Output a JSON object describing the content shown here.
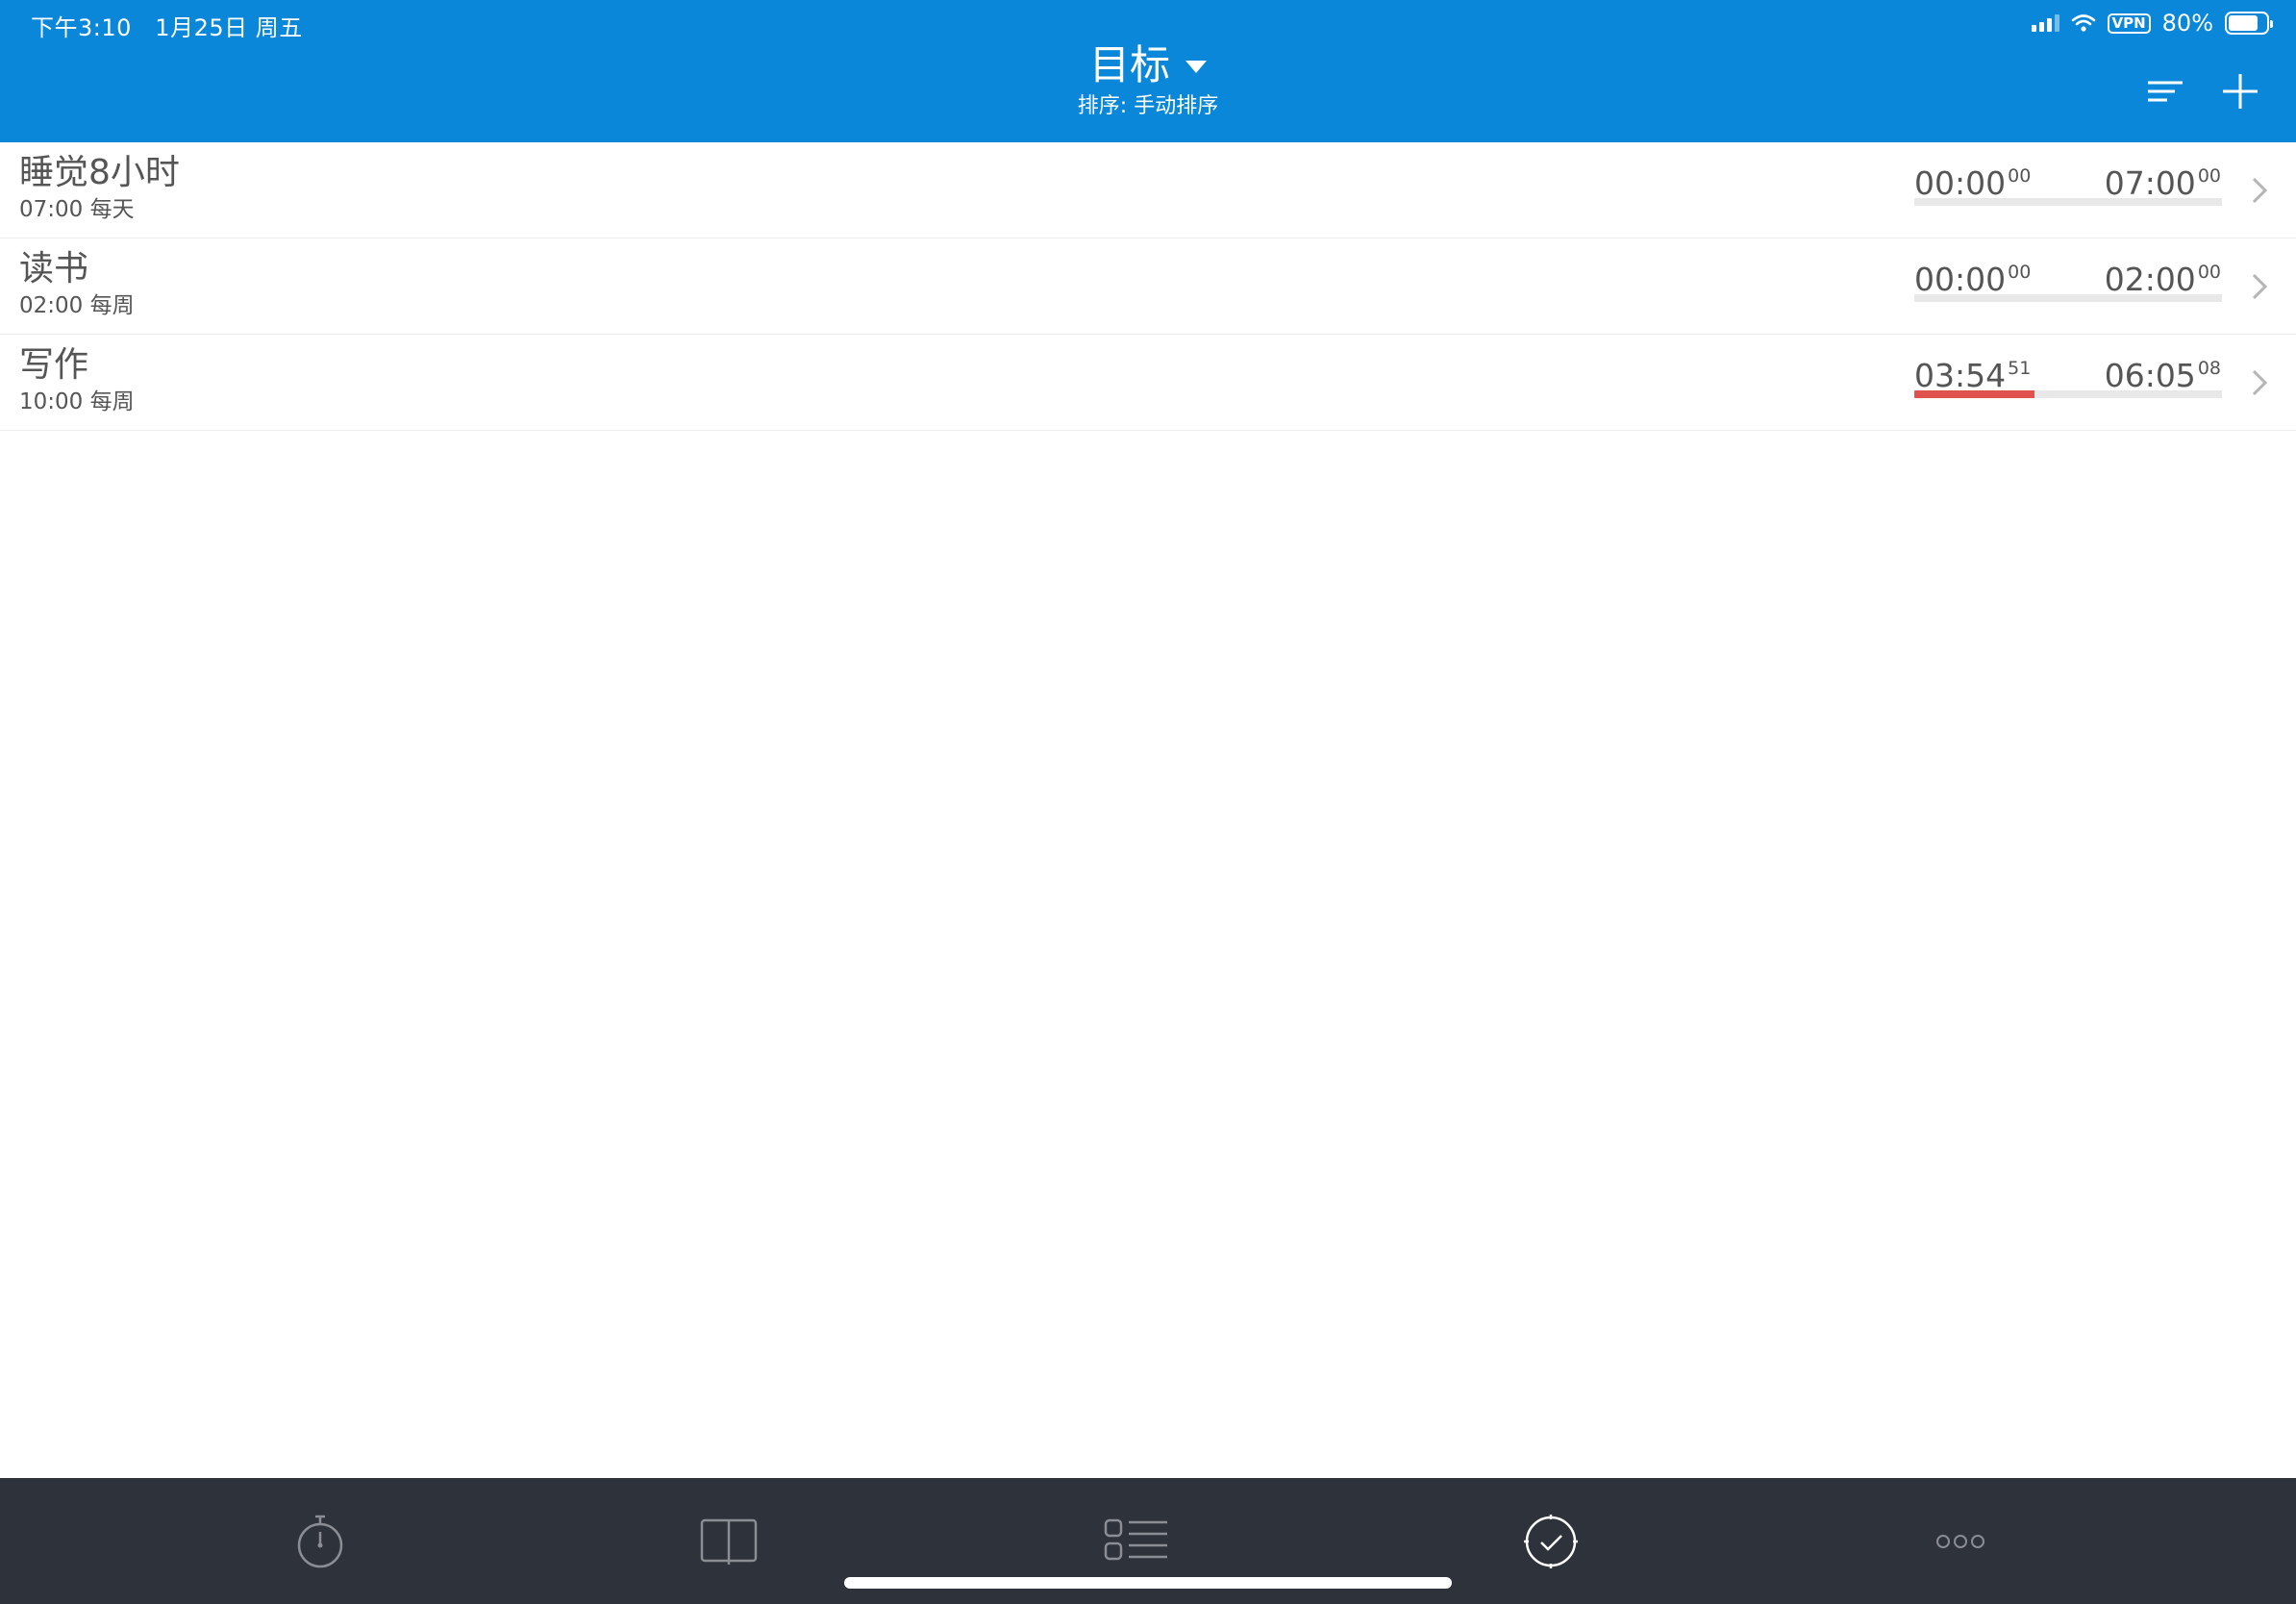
{
  "status_bar": {
    "time": "下午3:10",
    "date": "1月25日 周五",
    "vpn": "VPN",
    "battery_text": "80%",
    "battery_level": 0.8
  },
  "header": {
    "title": "目标",
    "subtitle": "排序: 手动排序",
    "background_color": "#0A87D9",
    "icons": [
      "sort-icon",
      "plus-icon",
      "chevron-down-icon"
    ]
  },
  "goals": [
    {
      "title": "睡觉8小时",
      "subtitle": "07:00 每天",
      "done_main": "00:00",
      "done_sup": "00",
      "left_main": "07:00",
      "left_sup": "00",
      "progress": 0.0
    },
    {
      "title": "读书",
      "subtitle": "02:00 每周",
      "done_main": "00:00",
      "done_sup": "00",
      "left_main": "02:00",
      "left_sup": "00",
      "progress": 0.0
    },
    {
      "title": "写作",
      "subtitle": "10:00 每周",
      "done_main": "03:54",
      "done_sup": "51",
      "left_main": "06:05",
      "left_sup": "08",
      "progress": 0.39
    }
  ],
  "colors": {
    "progress_fill": "#E0524E",
    "progress_track": "#E8E8E8",
    "tabbar_background": "#2E323A"
  },
  "tabbar": {
    "tabs": [
      {
        "icon": "stopwatch-icon",
        "active": false
      },
      {
        "icon": "book-icon",
        "active": false
      },
      {
        "icon": "list-icon",
        "active": false
      },
      {
        "icon": "check-circle-icon",
        "active": true
      },
      {
        "icon": "more-icon",
        "active": false
      }
    ]
  }
}
